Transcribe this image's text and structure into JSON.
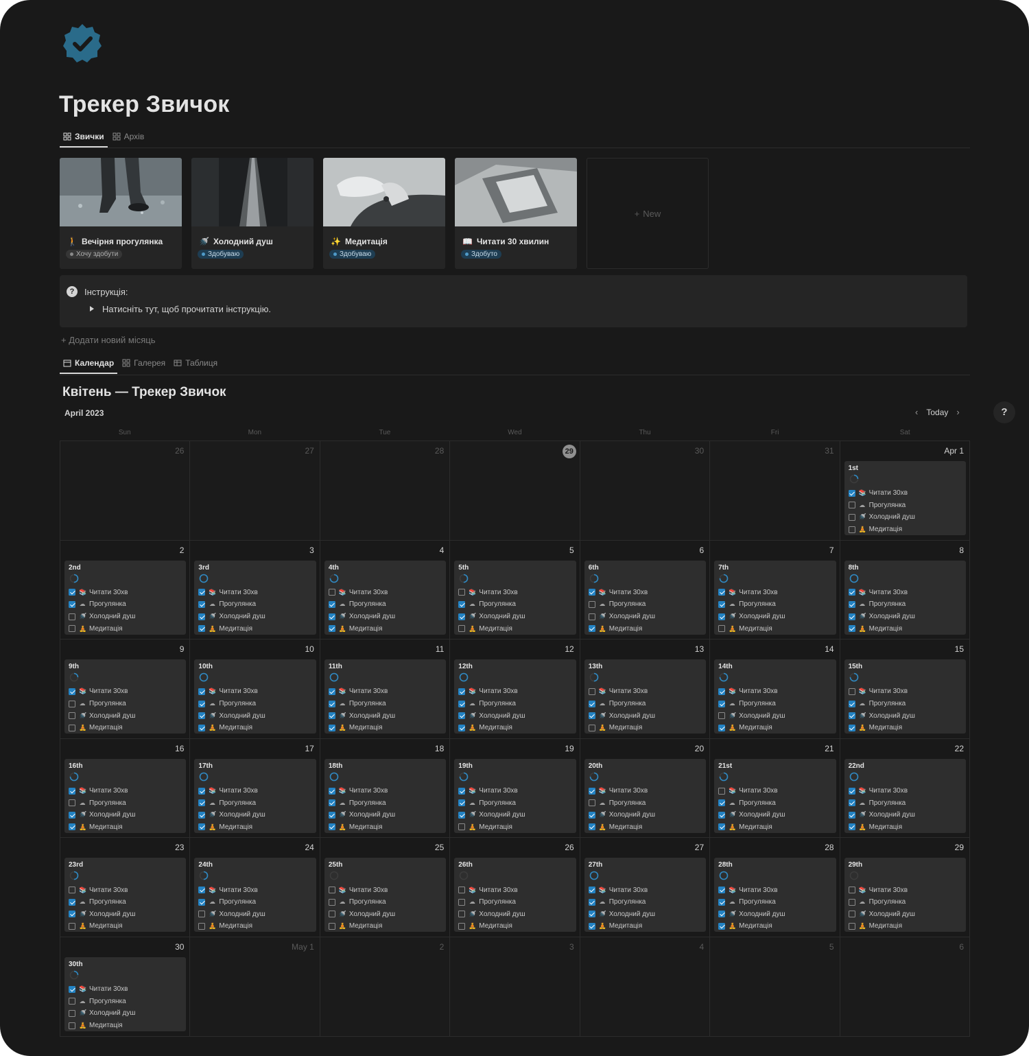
{
  "page": {
    "title": "Трекер Звичок",
    "accent": "#2383c4"
  },
  "top_tabs": [
    {
      "label": "Звички",
      "icon": "gallery-icon",
      "active": true
    },
    {
      "label": "Архів",
      "icon": "gallery-icon",
      "active": false
    }
  ],
  "habits": [
    {
      "name": "Вечірня прогулянка",
      "icon": "walking-person-icon",
      "status": "Хочу здобути",
      "status_color": "gray"
    },
    {
      "name": "Холодний душ",
      "icon": "shower-icon",
      "status": "Здобуваю",
      "status_color": "blue"
    },
    {
      "name": "Медитація",
      "icon": "sparkles-icon",
      "status": "Здобуваю",
      "status_color": "blue"
    },
    {
      "name": "Читати 30 хвилин",
      "icon": "book-icon",
      "status": "Здобуто",
      "status_color": "blue"
    }
  ],
  "new_card": {
    "label": "New"
  },
  "callout": {
    "title": "Інструкція:",
    "toggle": "Натисніть тут, щоб прочитати інструкцію."
  },
  "add_month": "Додати новий місяць",
  "view_tabs": [
    {
      "label": "Календар",
      "icon": "calendar-icon",
      "active": true
    },
    {
      "label": "Галерея",
      "icon": "gallery-icon",
      "active": false
    },
    {
      "label": "Таблиця",
      "icon": "table-icon",
      "active": false
    }
  ],
  "calendar": {
    "title": "Квітень — Трекер Звичок",
    "month_label": "April 2023",
    "today_button": "Today",
    "help": "?",
    "weekdays": [
      "Sun",
      "Mon",
      "Tue",
      "Wed",
      "Thu",
      "Fri",
      "Sat"
    ],
    "habit_labels": [
      "Читати 30хв",
      "Прогулянка",
      "Холодний душ",
      "Медитація"
    ],
    "habit_icons": [
      "book-icon",
      "walk-icon",
      "shower-icon",
      "meditation-icon"
    ],
    "cells": [
      {
        "day": "26",
        "dim": true
      },
      {
        "day": "27",
        "dim": true
      },
      {
        "day": "28",
        "dim": true
      },
      {
        "day": "29",
        "dim": true,
        "today": true
      },
      {
        "day": "30",
        "dim": true
      },
      {
        "day": "31",
        "dim": true
      },
      {
        "day": "Apr 1",
        "label": "1st",
        "checks": [
          1,
          0,
          0,
          0
        ],
        "progress": 0.25
      },
      {
        "day": "2",
        "label": "2nd",
        "checks": [
          1,
          1,
          0,
          0
        ],
        "progress": 0.5
      },
      {
        "day": "3",
        "label": "3rd",
        "checks": [
          1,
          1,
          1,
          1
        ],
        "progress": 1
      },
      {
        "day": "4",
        "label": "4th",
        "checks": [
          0,
          1,
          1,
          1
        ],
        "progress": 0.75
      },
      {
        "day": "5",
        "label": "5th",
        "checks": [
          0,
          1,
          1,
          0
        ],
        "progress": 0.5
      },
      {
        "day": "6",
        "label": "6th",
        "checks": [
          1,
          0,
          0,
          1
        ],
        "progress": 0.5
      },
      {
        "day": "7",
        "label": "7th",
        "checks": [
          1,
          1,
          1,
          0
        ],
        "progress": 0.75
      },
      {
        "day": "8",
        "label": "8th",
        "checks": [
          1,
          1,
          1,
          1
        ],
        "progress": 1
      },
      {
        "day": "9",
        "label": "9th",
        "checks": [
          1,
          0,
          0,
          0
        ],
        "progress": 0.25
      },
      {
        "day": "10",
        "label": "10th",
        "checks": [
          1,
          1,
          1,
          1
        ],
        "progress": 1
      },
      {
        "day": "11",
        "label": "11th",
        "checks": [
          1,
          1,
          1,
          1
        ],
        "progress": 1
      },
      {
        "day": "12",
        "label": "12th",
        "checks": [
          1,
          1,
          1,
          1
        ],
        "progress": 1
      },
      {
        "day": "13",
        "label": "13th",
        "checks": [
          0,
          1,
          1,
          0
        ],
        "progress": 0.5
      },
      {
        "day": "14",
        "label": "14th",
        "checks": [
          1,
          1,
          0,
          1
        ],
        "progress": 0.75
      },
      {
        "day": "15",
        "label": "15th",
        "checks": [
          0,
          1,
          1,
          1
        ],
        "progress": 0.75
      },
      {
        "day": "16",
        "label": "16th",
        "checks": [
          1,
          0,
          1,
          1
        ],
        "progress": 0.75
      },
      {
        "day": "17",
        "label": "17th",
        "checks": [
          1,
          1,
          1,
          1
        ],
        "progress": 1
      },
      {
        "day": "18",
        "label": "18th",
        "checks": [
          1,
          1,
          1,
          1
        ],
        "progress": 1
      },
      {
        "day": "19",
        "label": "19th",
        "checks": [
          1,
          1,
          1,
          0
        ],
        "progress": 0.75
      },
      {
        "day": "20",
        "label": "20th",
        "checks": [
          1,
          0,
          1,
          1
        ],
        "progress": 0.75
      },
      {
        "day": "21",
        "label": "21st",
        "checks": [
          0,
          1,
          1,
          1
        ],
        "progress": 0.75
      },
      {
        "day": "22",
        "label": "22nd",
        "checks": [
          1,
          1,
          1,
          1
        ],
        "progress": 1
      },
      {
        "day": "23",
        "label": "23rd",
        "checks": [
          0,
          1,
          1,
          0
        ],
        "progress": 0.5
      },
      {
        "day": "24",
        "label": "24th",
        "checks": [
          1,
          1,
          0,
          0
        ],
        "progress": 0.5
      },
      {
        "day": "25",
        "label": "25th",
        "checks": [
          0,
          0,
          0,
          0
        ],
        "progress": 0
      },
      {
        "day": "26",
        "label": "26th",
        "checks": [
          0,
          0,
          0,
          0
        ],
        "progress": 0
      },
      {
        "day": "27",
        "label": "27th",
        "checks": [
          1,
          1,
          1,
          1
        ],
        "progress": 1
      },
      {
        "day": "28",
        "label": "28th",
        "checks": [
          1,
          1,
          1,
          1
        ],
        "progress": 1
      },
      {
        "day": "29",
        "label": "29th",
        "checks": [
          0,
          0,
          0,
          0
        ],
        "progress": 0
      },
      {
        "day": "30",
        "label": "30th",
        "checks": [
          1,
          0,
          0,
          0
        ],
        "progress": 0.25
      },
      {
        "day": "May 1",
        "dim": true
      },
      {
        "day": "2",
        "dim": true
      },
      {
        "day": "3",
        "dim": true
      },
      {
        "day": "4",
        "dim": true
      },
      {
        "day": "5",
        "dim": true
      },
      {
        "day": "6",
        "dim": true
      }
    ]
  }
}
